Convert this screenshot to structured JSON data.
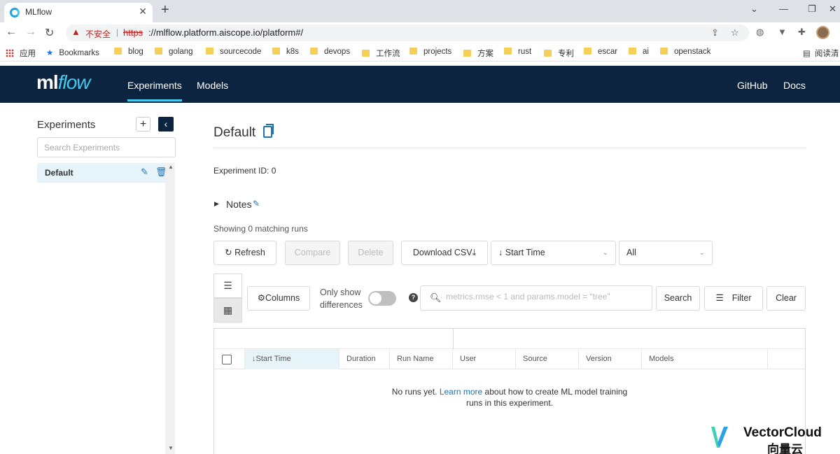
{
  "browser": {
    "tab_title": "MLflow",
    "tab_close": "✕",
    "new_tab": "+",
    "security_label": "不安全",
    "url_scheme": "https",
    "url_rest": "://mlflow.platform.aiscope.io/platform#/",
    "reader_mode": "阅读清",
    "bookmarks": [
      {
        "label": "应用",
        "kind": "apps"
      },
      {
        "label": "Bookmarks",
        "kind": "star"
      },
      {
        "label": "blog",
        "kind": "folder"
      },
      {
        "label": "golang",
        "kind": "folder"
      },
      {
        "label": "sourcecode",
        "kind": "folder"
      },
      {
        "label": "k8s",
        "kind": "folder"
      },
      {
        "label": "devops",
        "kind": "folder"
      },
      {
        "label": "工作流",
        "kind": "folder"
      },
      {
        "label": "projects",
        "kind": "folder"
      },
      {
        "label": "方案",
        "kind": "folder"
      },
      {
        "label": "rust",
        "kind": "folder"
      },
      {
        "label": "专利",
        "kind": "folder"
      },
      {
        "label": "escar",
        "kind": "folder"
      },
      {
        "label": "ai",
        "kind": "folder"
      },
      {
        "label": "openstack",
        "kind": "folder"
      }
    ]
  },
  "header": {
    "logo_ml": "ml",
    "logo_flow": "flow",
    "nav": [
      {
        "label": "Experiments",
        "active": true
      },
      {
        "label": "Models",
        "active": false
      }
    ],
    "links": [
      {
        "label": "GitHub"
      },
      {
        "label": "Docs"
      }
    ],
    "background_color": "#0d2440",
    "accent_color": "#43c9ef"
  },
  "sidebar": {
    "title": "Experiments",
    "add_label": "+",
    "collapse_label": "‹",
    "search_placeholder": "Search Experiments",
    "items": [
      {
        "label": "Default",
        "selected": true
      }
    ]
  },
  "main": {
    "title": "Default",
    "experiment_id_label": "Experiment ID:",
    "experiment_id_value": "0",
    "notes_label": "Notes",
    "showing_text": "Showing 0 matching runs",
    "buttons": {
      "refresh": "Refresh",
      "compare": "Compare",
      "delete": "Delete",
      "download_csv": "Download CSV",
      "columns": "Columns",
      "search": "Search",
      "filter": "Filter",
      "clear": "Clear"
    },
    "sort_select": "Start Time",
    "lifecycle_select": "All",
    "only_show_line1": "Only show",
    "only_show_line2": "differences",
    "only_show_enabled": false,
    "search_placeholder": "metrics.rmse < 1 and params.model = \"tree\"",
    "table": {
      "columns": [
        "Start Time",
        "Duration",
        "Run Name",
        "User",
        "Source",
        "Version",
        "Models"
      ],
      "sorted_column": "Start Time",
      "rows": [],
      "empty_prefix": "No runs yet.",
      "empty_link": "Learn more",
      "empty_suffix_line1": "about how to create ML model training",
      "empty_suffix_line2": "runs in this experiment."
    }
  },
  "watermark": {
    "name_en": "VectorCloud",
    "name_cn": "向量云"
  }
}
